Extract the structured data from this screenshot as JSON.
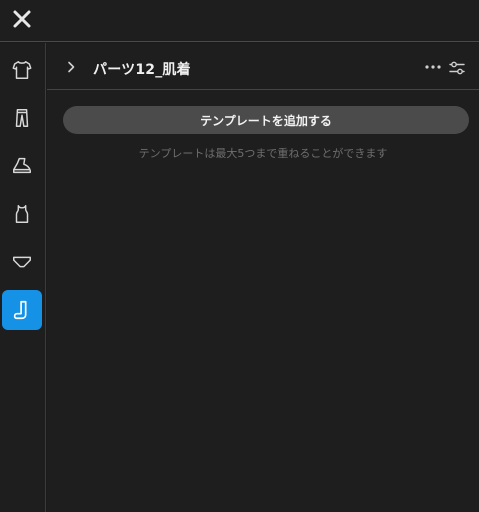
{
  "topbar": {
    "close_icon": "close-icon"
  },
  "rail": {
    "items": [
      {
        "icon": "tshirt-icon",
        "active": false
      },
      {
        "icon": "pants-icon",
        "active": false
      },
      {
        "icon": "shoe-icon",
        "active": false
      },
      {
        "icon": "tank-top-icon",
        "active": false
      },
      {
        "icon": "underwear-icon",
        "active": false
      },
      {
        "icon": "sock-icon",
        "active": true
      }
    ],
    "accent_color": "#1592e6"
  },
  "panel": {
    "title": "パーツ12_肌着",
    "add_button_label": "テンプレートを追加する",
    "hint": "テンプレートは最大5つまで重ねることができます"
  }
}
